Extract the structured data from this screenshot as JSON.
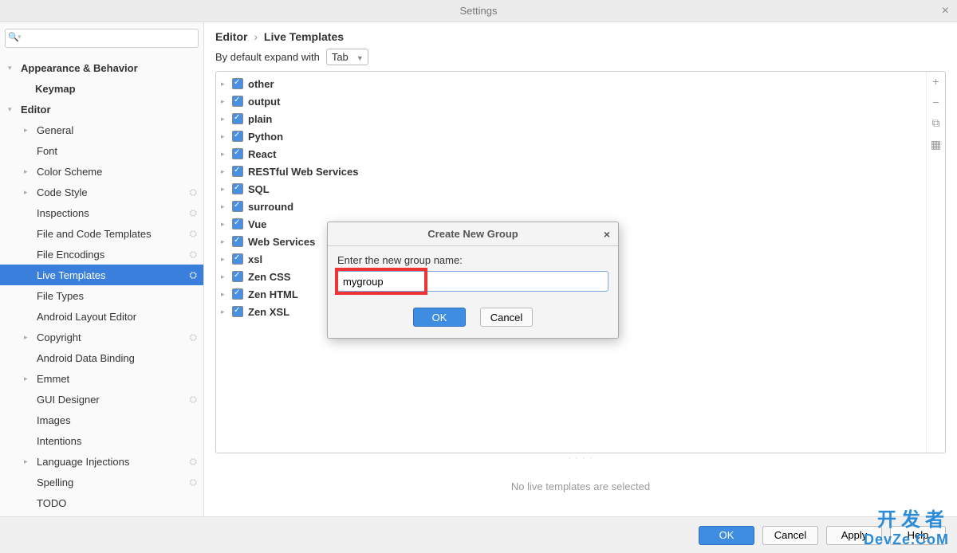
{
  "window": {
    "title": "Settings",
    "close": "×"
  },
  "search": {
    "placeholder": ""
  },
  "sidebar": {
    "items": [
      {
        "label": "Appearance & Behavior",
        "level": 1,
        "expand": "▾",
        "bold": true
      },
      {
        "label": "Keymap",
        "level": 1,
        "expand": "",
        "bold": true,
        "indent": true
      },
      {
        "label": "Editor",
        "level": 1,
        "expand": "▾",
        "bold": true
      },
      {
        "label": "General",
        "level": 2,
        "expand": "▸"
      },
      {
        "label": "Font",
        "level": 2,
        "expand": ""
      },
      {
        "label": "Color Scheme",
        "level": 2,
        "expand": "▸"
      },
      {
        "label": "Code Style",
        "level": 2,
        "expand": "▸",
        "gear": true
      },
      {
        "label": "Inspections",
        "level": 2,
        "gear": true
      },
      {
        "label": "File and Code Templates",
        "level": 2,
        "gear": true
      },
      {
        "label": "File Encodings",
        "level": 2,
        "gear": true
      },
      {
        "label": "Live Templates",
        "level": 2,
        "selected": true,
        "gear": true
      },
      {
        "label": "File Types",
        "level": 2
      },
      {
        "label": "Android Layout Editor",
        "level": 2
      },
      {
        "label": "Copyright",
        "level": 2,
        "expand": "▸",
        "gear": true
      },
      {
        "label": "Android Data Binding",
        "level": 2
      },
      {
        "label": "Emmet",
        "level": 2,
        "expand": "▸"
      },
      {
        "label": "GUI Designer",
        "level": 2,
        "gear": true
      },
      {
        "label": "Images",
        "level": 2
      },
      {
        "label": "Intentions",
        "level": 2
      },
      {
        "label": "Language Injections",
        "level": 2,
        "expand": "▸",
        "gear": true
      },
      {
        "label": "Spelling",
        "level": 2,
        "gear": true
      },
      {
        "label": "TODO",
        "level": 2
      }
    ]
  },
  "breadcrumb": {
    "part1": "Editor",
    "part2": "Live Templates",
    "sep": "›"
  },
  "expand": {
    "label": "By default expand with",
    "value": "Tab"
  },
  "templates": [
    "other",
    "output",
    "plain",
    "Python",
    "React",
    "RESTful Web Services",
    "SQL",
    "surround",
    "Vue",
    "Web Services",
    "xsl",
    "Zen CSS",
    "Zen HTML",
    "Zen XSL"
  ],
  "side_icons": {
    "add": "+",
    "remove": "−",
    "copy": "⧉",
    "paste": "▦"
  },
  "empty_status": "No live templates are selected",
  "dialog": {
    "title": "Create New Group",
    "close": "×",
    "prompt": "Enter the new group name:",
    "value": "mygroup",
    "ok": "OK",
    "cancel": "Cancel"
  },
  "footer": {
    "ok": "OK",
    "cancel": "Cancel",
    "apply": "Apply",
    "help": "Help"
  },
  "watermark": {
    "cn": "开发者",
    "en": "DevZe.CoM"
  }
}
